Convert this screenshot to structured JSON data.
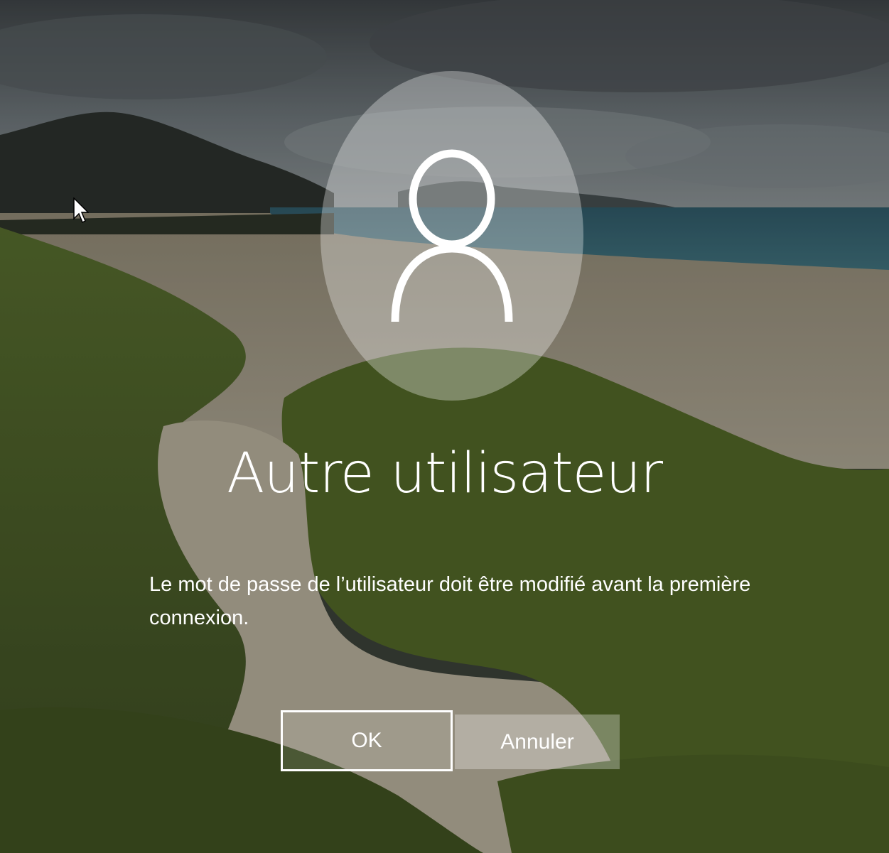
{
  "user": {
    "name": "Autre utilisateur"
  },
  "message": {
    "text": "Le mot de passe de l’utilisateur doit être modifié avant la première connexion."
  },
  "buttons": {
    "ok_label": "OK",
    "cancel_label": "Annuler"
  },
  "icons": {
    "avatar": "user-silhouette-icon",
    "cursor": "mouse-pointer-icon"
  },
  "colors": {
    "text": "#ffffff",
    "button_border": "#ffffff"
  }
}
